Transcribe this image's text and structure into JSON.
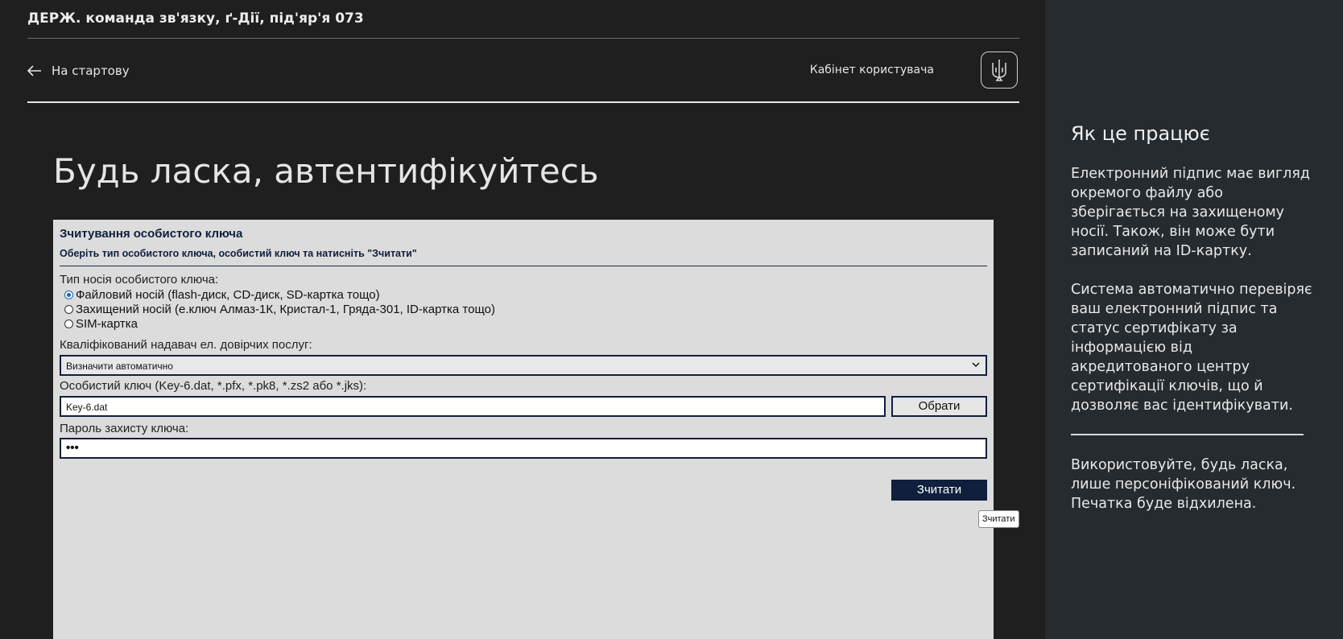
{
  "header": {
    "org_title": "ДЕРЖ. команда зв'язку, ґ-Дії, під'яр'я 073",
    "back_label": "На стартову",
    "cabinet_label": "Кабінет користувача"
  },
  "page_title": "Будь ласка, автентифікуйтесь",
  "form": {
    "title": "Зчитування особистого ключа",
    "subtitle": "Оберіть тип особистого ключа, особистий ключ та натисніть \"Зчитати\"",
    "media_label": "Тип носія особистого ключа:",
    "media_options": [
      {
        "label": "Файловий носій (flash-диск, CD-диск, SD-картка тощо)",
        "selected": true
      },
      {
        "label": "Захищений носій (е.ключ Алмаз-1К, Кристал-1, Гряда-301, ID-картка тощо)",
        "selected": false
      },
      {
        "label": "SIM-картка",
        "selected": false
      }
    ],
    "provider_label": "Кваліфікований надавач ел. довірчих послуг:",
    "provider_value": "Визначити автоматично",
    "key_label": "Особистий ключ (Key-6.dat, *.pfx, *.pk8, *.zs2 або *.jks):",
    "key_value": "Key-6.dat",
    "browse_label": "Обрати",
    "password_label": "Пароль захисту ключа:",
    "password_value": "•••",
    "read_label": "Зчитати",
    "tooltip": "Зчитати"
  },
  "aside": {
    "title": "Як це працює",
    "para1": "Електронний підпис має вигляд окремого файлу або зберігається на захищеному носії. Також, він може бути записаний на ID-картку.",
    "para2": "Система автоматично перевіряє ваш електронний підпис та статус сертифікату за інформацією від акредитованого центру сертифікації ключів, що й дозволяє вас ідентифікувати.",
    "para3": "Використовуйте, будь ласка, лише персоніфікований ключ. Печатка буде відхилена."
  },
  "colors": {
    "page_bg": "#1f1f1f",
    "aside_bg": "#262b2f",
    "panel_bg": "#dcdcdc",
    "navy": "#0f1f3d"
  },
  "icons": [
    "arrow-left-icon",
    "trident-icon",
    "chevron-down-icon"
  ]
}
